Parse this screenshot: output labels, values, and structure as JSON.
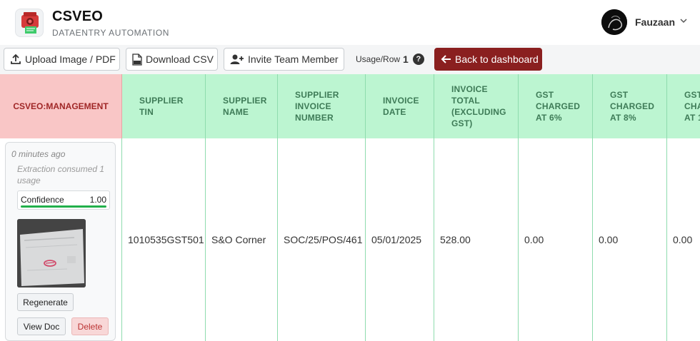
{
  "app": {
    "title": "CSVEO",
    "subtitle": "DATAENTRY AUTOMATION",
    "user_name": "Fauzaan"
  },
  "toolbar": {
    "upload_label": "Upload Image / PDF",
    "download_label": "Download CSV",
    "invite_label": "Invite Team Member",
    "usage_label": "Usage/Row",
    "usage_value": "1",
    "help_glyph": "?",
    "back_label": "Back to dashboard"
  },
  "table": {
    "management_header": "CSVEO:MANAGEMENT",
    "columns": [
      "SUPPLIER\nTIN",
      "SUPPLIER\nNAME",
      "SUPPLIER\nINVOICE\nNUMBER",
      "INVOICE\nDATE",
      "INVOICE\nTOTAL\n(EXCLUDING\nGST)",
      "GST\nCHARGED\nAT 6%",
      "GST\nCHARGED\nAT 8%",
      "GST\nCHA\nAT 1"
    ],
    "row": {
      "time": "0 minutes ago",
      "usage_note": "Extraction consumed 1 usage",
      "confidence_label": "Confidence",
      "confidence_value": "1.00",
      "confidence_fraction": 1.0,
      "regenerate_label": "Regenerate",
      "view_label": "View Doc",
      "delete_label": "Delete",
      "cells": [
        "1010535GST501",
        "S&O Corner",
        "SOC/25/POS/461",
        "05/01/2025",
        "528.00",
        "0.00",
        "0.00",
        "0.00"
      ]
    }
  },
  "colors": {
    "brand_red": "#8a1f1f",
    "management_header_bg": "#f9c6c6",
    "column_header_bg": "#bcf5d1",
    "confidence_bar": "#22b04b"
  },
  "icons": {
    "logo": "printer-scanner-logo",
    "upload": "upload-icon",
    "download": "csv-file-icon",
    "invite": "add-user-icon",
    "help": "help-icon",
    "back": "arrow-left-icon",
    "user_menu": "chevron-down-icon"
  }
}
